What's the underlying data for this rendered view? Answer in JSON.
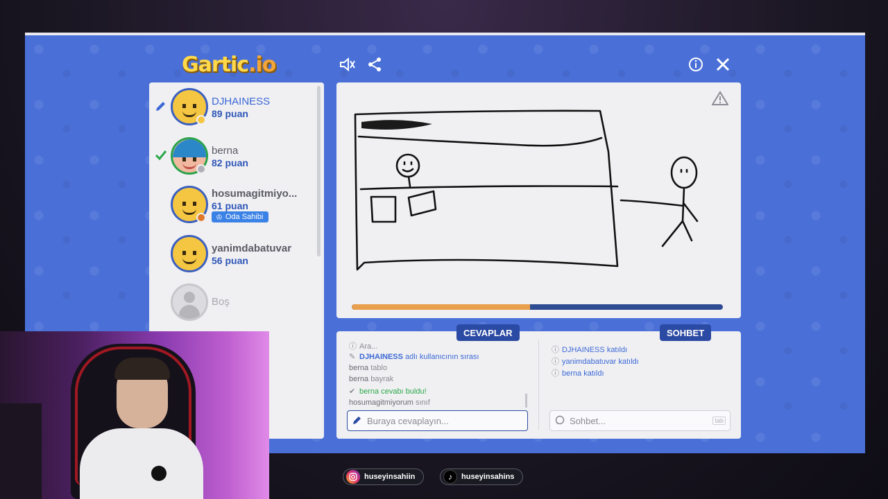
{
  "app": {
    "logo_main": "Gartic",
    "logo_suffix": ".io"
  },
  "top_bar": {
    "mute_icon": "speaker-muted-icon",
    "share_icon": "share-icon",
    "info_icon": "info-icon",
    "close_icon": "close-icon"
  },
  "players": [
    {
      "name": "DJHAINESS",
      "score": "89 puan",
      "status": "drawing",
      "avatar": "yellow-smiley"
    },
    {
      "name": "berna",
      "score": "82 puan",
      "status": "guessed",
      "avatar": "blue-hair-girl"
    },
    {
      "name": "hosumagitmiyo...",
      "score": "61 puan",
      "status": "",
      "avatar": "yellow-smiley",
      "badge": "Oda Sahibi"
    },
    {
      "name": "yanimdabatuvar",
      "score": "56 puan",
      "status": "",
      "avatar": "yellow-smiley"
    },
    {
      "name": "Boş",
      "score": "",
      "status": "empty",
      "avatar": "empty"
    }
  ],
  "canvas": {
    "warning_icon": "warning-triangle-icon",
    "timer_progress": 0.48
  },
  "tabs": {
    "answers": "CEVAPLAR",
    "chat": "SOHBET"
  },
  "answers": {
    "messages": [
      {
        "type": "system",
        "icon": "info-icon",
        "who": "",
        "text": "Ara..."
      },
      {
        "type": "turn",
        "icon": "pencil-icon",
        "who": "DJHAINESS",
        "text": "adlı kullanıcının sırası"
      },
      {
        "type": "guess",
        "who": "berna",
        "text": "tablo"
      },
      {
        "type": "guess",
        "who": "berna",
        "text": "bayrak"
      },
      {
        "type": "found",
        "icon": "check-icon",
        "who": "berna",
        "text": "cevabı buldu!"
      },
      {
        "type": "guess",
        "who": "hosumagitmiyorum",
        "text": "sınıf"
      }
    ],
    "input_placeholder": "Buraya cevaplayın..."
  },
  "chat": {
    "messages": [
      {
        "type": "join",
        "icon": "info-icon",
        "who": "DJHAINESS",
        "text": "katıldı"
      },
      {
        "type": "join",
        "icon": "info-icon",
        "who": "yanimdabatuvar",
        "text": "katıldı"
      },
      {
        "type": "join",
        "icon": "info-icon",
        "who": "berna",
        "text": "katıldı"
      }
    ],
    "input_placeholder": "Sohbet...",
    "key_hint": "tab"
  },
  "socials": {
    "instagram": "huseyinsahiin",
    "tiktok": "huseyinsahins"
  },
  "colors": {
    "background_blue": "#4a70d8",
    "panel": "#f0f0f2",
    "accent_blue": "#2b4aa3",
    "timer_orange": "#e9a04c",
    "success_green": "#2aa84a"
  }
}
